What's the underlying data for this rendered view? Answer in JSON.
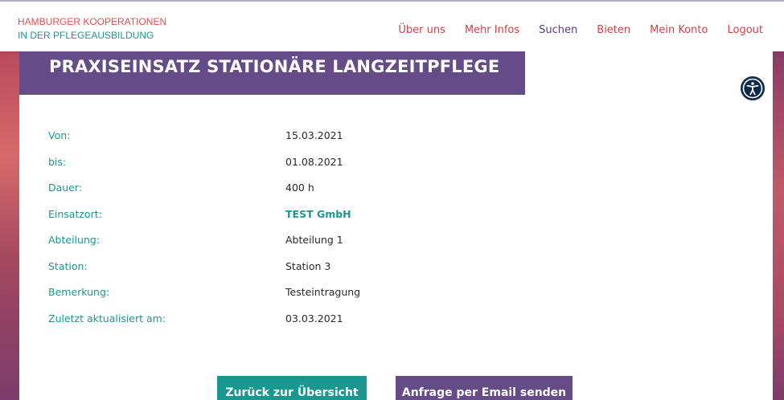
{
  "brand": {
    "line1": "HAMBURGER KOOPERATIONEN",
    "line2": "IN DER PFLEGEAUSBILDUNG"
  },
  "nav": {
    "items": [
      "Über uns",
      "Mehr Infos",
      "Suchen",
      "Bieten",
      "Mein Konto",
      "Logout"
    ],
    "active": "Suchen"
  },
  "page": {
    "title": "PRAXISEINSATZ STATIONÄRE LANGZEITPFLEGE"
  },
  "details": [
    {
      "label": "Von:",
      "value": "15.03.2021"
    },
    {
      "label": "bis:",
      "value": "01.08.2021"
    },
    {
      "label": "Dauer:",
      "value": "400 h"
    },
    {
      "label": "Einsatzort:",
      "value": "TEST GmbH"
    },
    {
      "label": "Abteilung:",
      "value": "Abteilung 1"
    },
    {
      "label": "Station:",
      "value": "Station 3"
    },
    {
      "label": "Bemerkung:",
      "value": "Testeintragung"
    },
    {
      "label": "Zuletzt aktualisiert am:",
      "value": "03.03.2021"
    }
  ],
  "buttons": {
    "back": "Zurück zur Übersicht",
    "email": "Anfrage per Email senden"
  },
  "icons": {
    "accessibility": "accessibility-icon"
  },
  "colors": {
    "primary_purple": "#654b88",
    "teal": "#1a9890",
    "red": "#d0404a"
  }
}
